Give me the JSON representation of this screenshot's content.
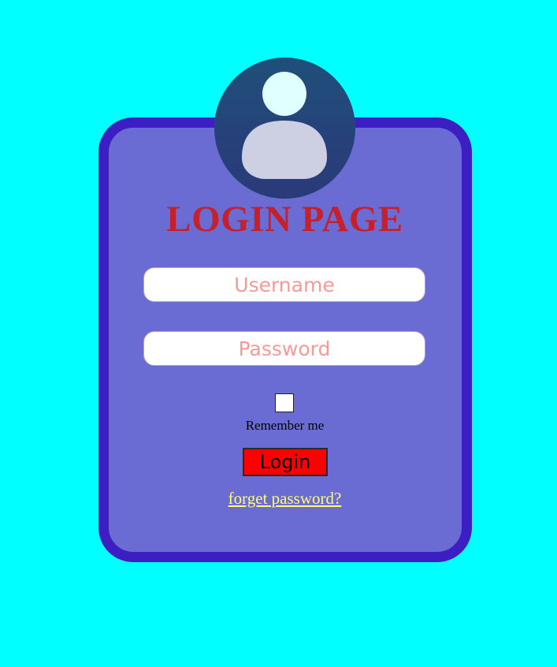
{
  "page": {
    "background_color": "#00ffff"
  },
  "card": {
    "background_color": "#6a6cd4",
    "border_color": "#3c1ec3"
  },
  "avatar": {
    "icon": "user-icon"
  },
  "title": {
    "text": "LOGIN PAGE",
    "color": "#c5202c"
  },
  "form": {
    "username_placeholder": "Username",
    "username_value": "",
    "password_placeholder": "Password",
    "password_value": "",
    "placeholder_color": "#f49b98",
    "remember_label": "Remember me",
    "remember_checked": false,
    "login_label": "Login",
    "login_color": "#ff0000",
    "forget_label": "forget password?",
    "forget_color": "#ffff66"
  }
}
